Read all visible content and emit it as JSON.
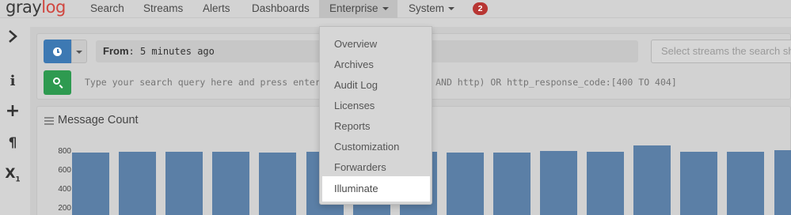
{
  "brand": {
    "part1": "gray",
    "part2": "log"
  },
  "nav": {
    "search": "Search",
    "streams": "Streams",
    "alerts": "Alerts",
    "dashboards": "Dashboards",
    "enterprise": "Enterprise",
    "system": "System",
    "notification_count": "2"
  },
  "sidebar": {
    "icons": [
      "chevron-right-icon",
      "info-icon",
      "plus-icon",
      "pilcrow-icon",
      "subscript-icon"
    ]
  },
  "search": {
    "from_label": "From",
    "from_value": ": 5 minutes ago",
    "streams_placeholder": "Select streams the search should",
    "query_placeholder": "Type your search query here and press enter. E.g.: (\"not found\" AND http) OR http_response_code:[400 TO 404]"
  },
  "widget": {
    "title": "Message Count",
    "y_ticks": [
      "800",
      "600",
      "400",
      "200"
    ]
  },
  "enterprise_menu": {
    "items": [
      "Overview",
      "Archives",
      "Audit Log",
      "Licenses",
      "Reports",
      "Customization",
      "Forwarders",
      "Illuminate"
    ],
    "highlighted": "Illuminate"
  },
  "chart_data": {
    "type": "bar",
    "y_ticks": [
      800,
      600,
      400,
      200
    ],
    "values": [
      780,
      790,
      790,
      795,
      785,
      790,
      780,
      790,
      780,
      785,
      800,
      790,
      860,
      790,
      795,
      805
    ],
    "ylim": [
      0,
      900
    ],
    "color": "#5b7fa6"
  },
  "colors": {
    "accent_blue": "#3d79b3",
    "search_green": "#2e9a50",
    "badge_red": "#b83633",
    "logo_red": "#d0463f"
  }
}
